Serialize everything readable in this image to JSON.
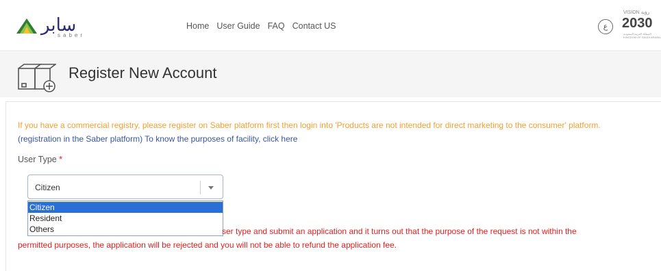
{
  "header": {
    "logo_ar": "سابر",
    "logo_en": "saber",
    "nav": [
      {
        "label": "Home"
      },
      {
        "label": "User Guide"
      },
      {
        "label": "FAQ"
      },
      {
        "label": "Contact US"
      }
    ],
    "lang_label": "ع",
    "vision_top": "VISION رؤية",
    "vision_year": "2030",
    "vision_sub": "المملكة العربية السعودية KINGDOM OF SAUDI ARABIA"
  },
  "page": {
    "title": "Register New Account"
  },
  "form": {
    "notice_part1": "If you have a commercial registry, please register on Saber platform first then login into 'Products are not intended for direct marketing to the consumer' platform. ",
    "notice_part2": "(registration in the Saber platform)",
    "notice_part3": " To know the purposes of facility, click here",
    "user_type_label": "User Type",
    "required_mark": "*",
    "select_value": "Citizen",
    "options": [
      "Citizen",
      "Resident",
      "Others"
    ],
    "selected_index": 0,
    "warning_line1": "ser type and submit an application and it turns out that the purpose of the request is not within the",
    "warning_line2": "permitted purposes, the application will be rejected and you will not be able to refund the application fee."
  },
  "colors": {
    "notice": "#f0a030",
    "link": "#3a55a0",
    "warning": "#e02020",
    "selected_option": "#2a6fd6"
  }
}
